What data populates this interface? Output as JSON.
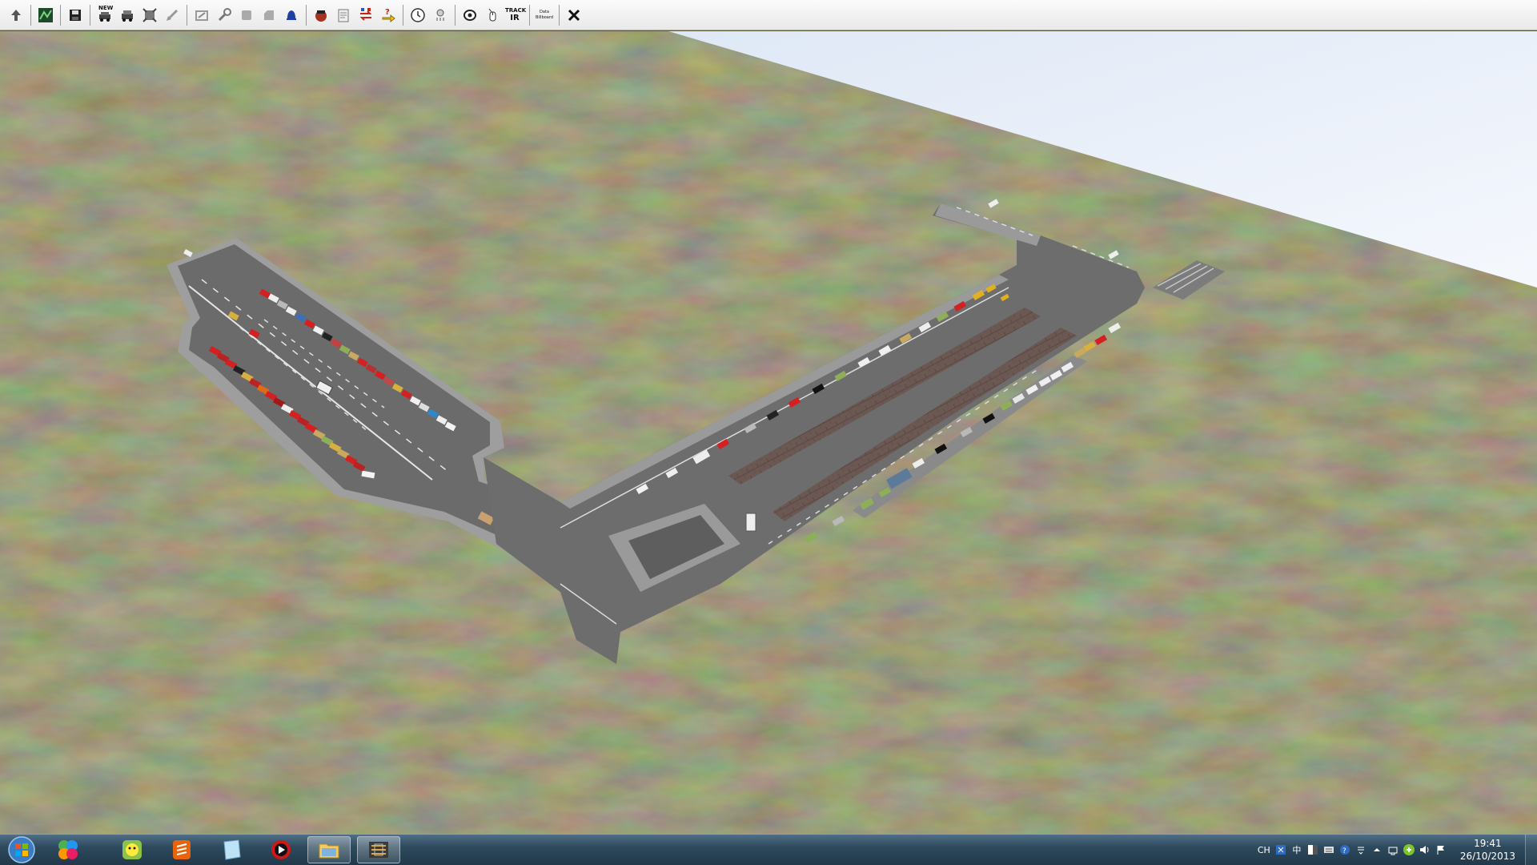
{
  "toolbar": {
    "buttons": [
      {
        "name": "up-arrow-icon"
      },
      {
        "name": "map-view-icon"
      },
      {
        "name": "save-icon"
      },
      {
        "name": "new-vehicle-icon",
        "label": "NEW"
      },
      {
        "name": "vehicle-icon"
      },
      {
        "name": "frame-icon"
      },
      {
        "name": "drag-arrow-icon"
      },
      {
        "name": "route-edit-icon"
      },
      {
        "name": "wrench-icon"
      },
      {
        "name": "gray-block-icon"
      },
      {
        "name": "gray-block-2-icon"
      },
      {
        "name": "bell-icon"
      },
      {
        "name": "driver-icon"
      },
      {
        "name": "document-icon"
      },
      {
        "name": "swap-icon"
      },
      {
        "name": "help-arrow-icon"
      },
      {
        "name": "clock-icon"
      },
      {
        "name": "weather-icon"
      },
      {
        "name": "camera-eye-icon"
      },
      {
        "name": "mouse-icon"
      },
      {
        "name": "trackir-icon",
        "label_top": "TRACK",
        "label_bottom": "IR"
      },
      {
        "name": "data-icon",
        "label_top": "Data",
        "label_bottom": "Billboard"
      },
      {
        "name": "close-icon"
      }
    ]
  },
  "colors": {
    "grass": "#5b5a3a",
    "sky": "#eef3fb",
    "asphalt": "#6d6d6d",
    "curb": "#9a9a9a",
    "brick": "#6e5a55",
    "taskbar": "#2f4a5e"
  },
  "taskbar": {
    "items": [
      {
        "name": "colorful-app-icon"
      },
      {
        "name": "messenger-icon"
      },
      {
        "name": "sublime-icon"
      },
      {
        "name": "notes-icon"
      },
      {
        "name": "media-player-icon"
      },
      {
        "name": "file-explorer-icon"
      },
      {
        "name": "simulator-app-icon"
      }
    ],
    "tray": {
      "lang": "CH",
      "ime": "中",
      "time": "19:41",
      "date": "26/10/2013"
    }
  }
}
